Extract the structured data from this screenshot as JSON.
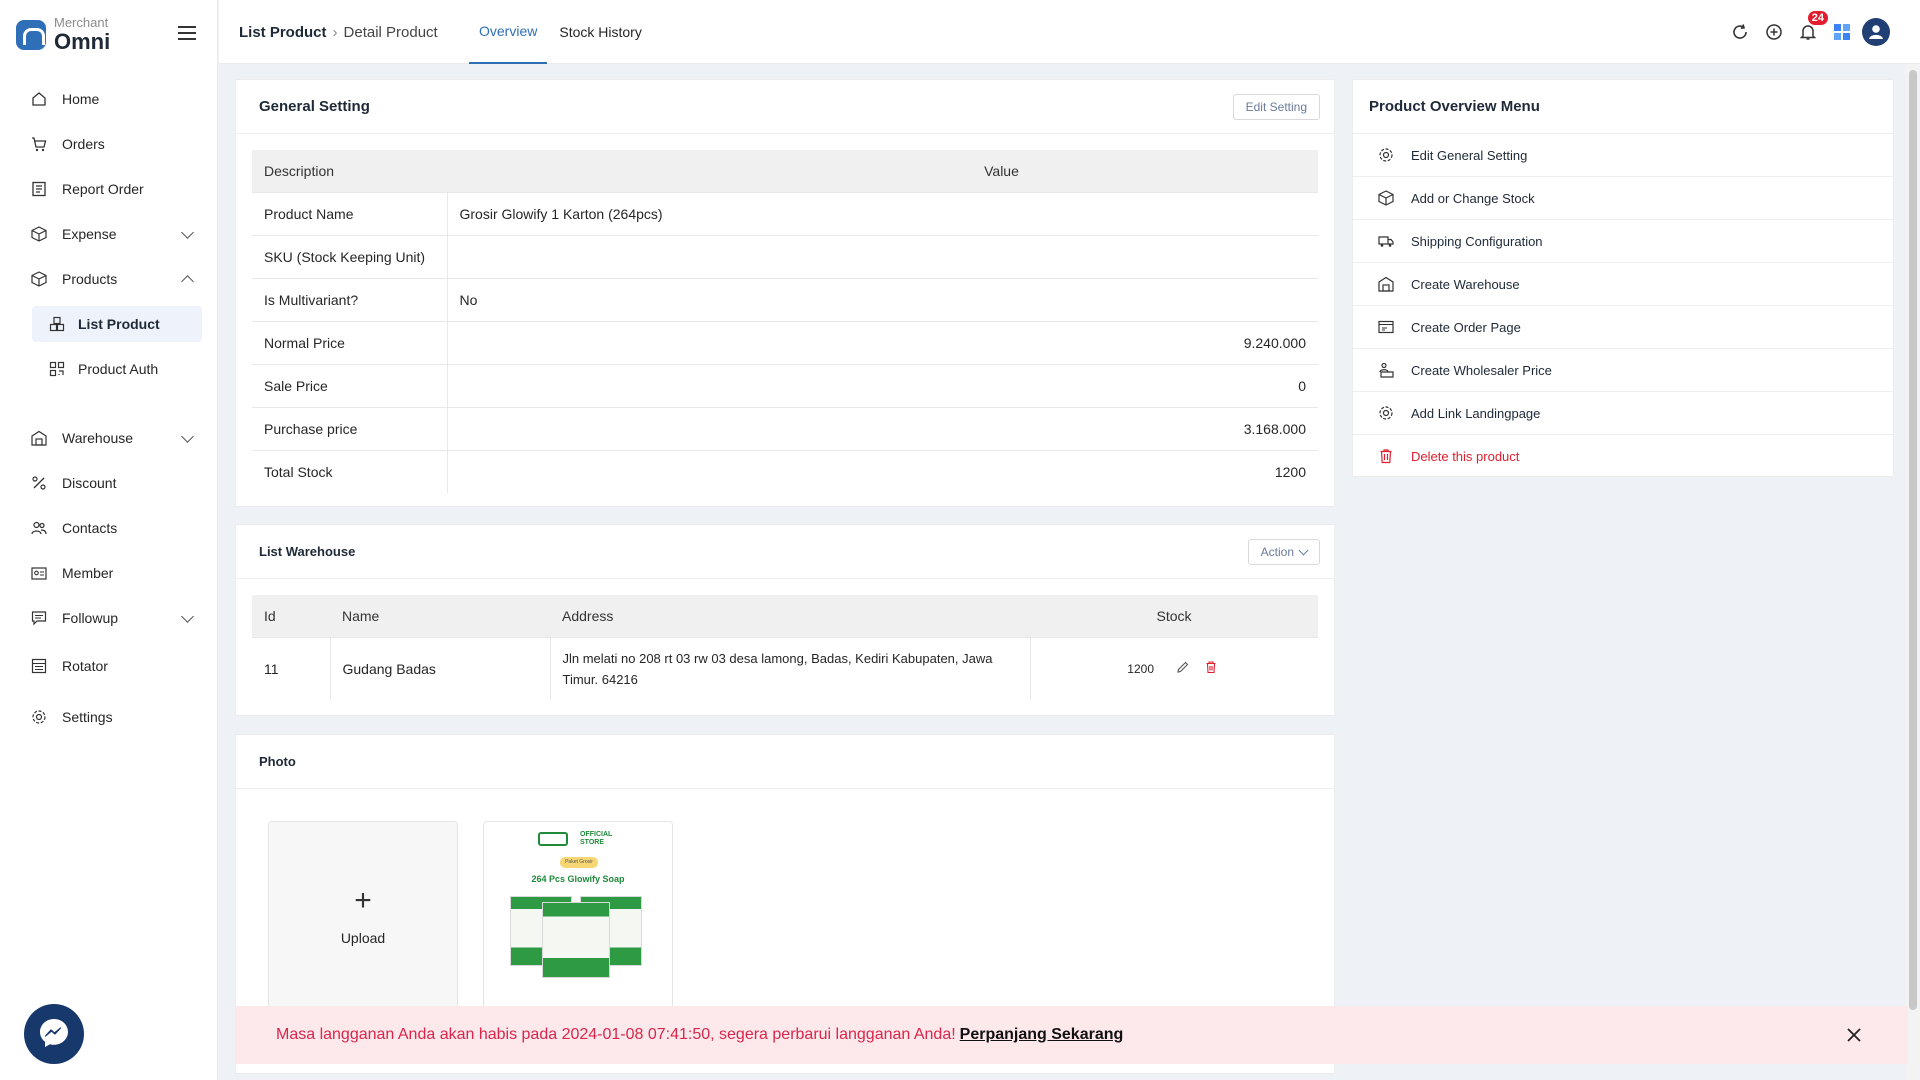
{
  "app": {
    "brand_small": "Merchant",
    "brand_big": "Omni"
  },
  "sidebar": {
    "items": [
      {
        "label": "Home"
      },
      {
        "label": "Orders"
      },
      {
        "label": "Report Order"
      },
      {
        "label": "Expense"
      },
      {
        "label": "Products"
      },
      {
        "label": "Warehouse"
      },
      {
        "label": "Discount"
      },
      {
        "label": "Contacts"
      },
      {
        "label": "Member"
      },
      {
        "label": "Followup"
      },
      {
        "label": "Rotator"
      },
      {
        "label": "Settings"
      }
    ],
    "sub_items": [
      {
        "label": "List Product",
        "active": true
      },
      {
        "label": "Product Auth"
      }
    ]
  },
  "header": {
    "breadcrumb": [
      "List Product",
      "Detail Product"
    ],
    "tabs": [
      {
        "label": "Overview",
        "active": true
      },
      {
        "label": "Stock History"
      }
    ],
    "notification_count": "24"
  },
  "general": {
    "title": "General Setting",
    "edit_label": "Edit Setting",
    "col_desc": "Description",
    "col_value": "Value",
    "rows": [
      {
        "label": "Product Name",
        "value": "Grosir Glowify 1 Karton (264pcs)"
      },
      {
        "label": "SKU (Stock Keeping Unit)",
        "value": ""
      },
      {
        "label": "Is Multivariant?",
        "value": "No"
      },
      {
        "label": "Normal Price",
        "value": "9.240.000"
      },
      {
        "label": "Sale Price",
        "value": "0"
      },
      {
        "label": "Purchase price",
        "value": "3.168.000"
      },
      {
        "label": "Total Stock",
        "value": "1200"
      }
    ]
  },
  "warehouse": {
    "title": "List Warehouse",
    "action_label": "Action",
    "headers": {
      "id": "Id",
      "name": "Name",
      "address": "Address",
      "stock": "Stock"
    },
    "rows": [
      {
        "id": "11",
        "name": "Gudang Badas",
        "address": "Jln melati no 208 rt 03 rw 03 desa lamong, Badas, Kediri Kabupaten, Jawa Timur. 64216",
        "stock": "1200"
      }
    ]
  },
  "photo": {
    "title": "Photo",
    "upload_label": "Upload",
    "thumb": {
      "store": "OFFICIAL STORE",
      "tag": "Paket Grosir",
      "caption": "264 Pcs Glowify Soap"
    }
  },
  "overview_menu": {
    "title": "Product Overview Menu",
    "items": [
      {
        "label": "Edit General Setting"
      },
      {
        "label": "Add or Change Stock"
      },
      {
        "label": "Shipping Configuration"
      },
      {
        "label": "Create Warehouse"
      },
      {
        "label": "Create Order Page"
      },
      {
        "label": "Create Wholesaler Price"
      },
      {
        "label": "Add Link Landingpage"
      },
      {
        "label": "Delete this product"
      }
    ]
  },
  "banner": {
    "text": "Masa langganan Anda akan habis pada 2024-01-08 07:41:50, segera perbarui langganan Anda!",
    "link": "Perpanjang Sekarang"
  },
  "colors": {
    "accent": "#2f6fb8",
    "danger": "#e11d2e",
    "banner_bg": "#fde8ec"
  }
}
